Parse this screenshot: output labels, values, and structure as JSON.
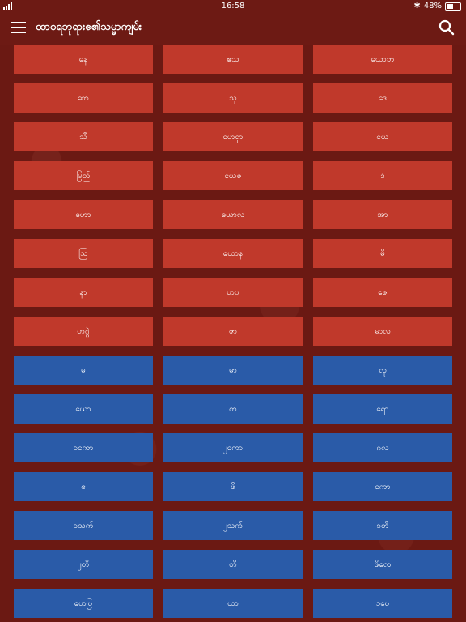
{
  "status_bar": {
    "time": "16:58",
    "bluetooth": "✱",
    "battery_percent": "48%",
    "battery_level": 0.48
  },
  "nav": {
    "title": "ထာဝရဘုရားဧ၏သမ္မာကျမ်း",
    "menu_icon": "hamburger-icon",
    "search_icon": "search-icon"
  },
  "colors": {
    "red": "#c0392b",
    "blue": "#2a5ba8",
    "background": "#6d1a14"
  },
  "books": [
    {
      "label": "နေ",
      "color": "red"
    },
    {
      "label": "ဧသ",
      "color": "red"
    },
    {
      "label": "ယောဘ",
      "color": "red"
    },
    {
      "label": "ဆာ",
      "color": "red"
    },
    {
      "label": "သု",
      "color": "red"
    },
    {
      "label": "ဒေ",
      "color": "red"
    },
    {
      "label": "သီ",
      "color": "red"
    },
    {
      "label": "ဟေရှာ",
      "color": "red"
    },
    {
      "label": "ယေ",
      "color": "red"
    },
    {
      "label": "မြည်",
      "color": "red"
    },
    {
      "label": "ယေဇ",
      "color": "red"
    },
    {
      "label": "ဒံ",
      "color": "red"
    },
    {
      "label": "ဟော",
      "color": "red"
    },
    {
      "label": "ယောလ",
      "color": "red"
    },
    {
      "label": "အာ",
      "color": "red"
    },
    {
      "label": "ဩ",
      "color": "red"
    },
    {
      "label": "ယောန",
      "color": "red"
    },
    {
      "label": "မိ",
      "color": "red"
    },
    {
      "label": "နာ",
      "color": "red"
    },
    {
      "label": "ဟဗ",
      "color": "red"
    },
    {
      "label": "ဇေ",
      "color": "red"
    },
    {
      "label": "ဟဂ္ဂဲ",
      "color": "red"
    },
    {
      "label": "ဇာ",
      "color": "red"
    },
    {
      "label": "မာလ",
      "color": "red"
    },
    {
      "label": "မ",
      "color": "blue"
    },
    {
      "label": "မာ",
      "color": "blue"
    },
    {
      "label": "လု",
      "color": "blue"
    },
    {
      "label": "ယော",
      "color": "blue"
    },
    {
      "label": "တ",
      "color": "blue"
    },
    {
      "label": "ရော",
      "color": "blue"
    },
    {
      "label": "၁ကော",
      "color": "blue"
    },
    {
      "label": "၂ကော",
      "color": "blue"
    },
    {
      "label": "ဂလ",
      "color": "blue"
    },
    {
      "label": "ဧ",
      "color": "blue"
    },
    {
      "label": "ဖိ",
      "color": "blue"
    },
    {
      "label": "ကော",
      "color": "blue"
    },
    {
      "label": "၁သက်",
      "color": "blue"
    },
    {
      "label": "၂သက်",
      "color": "blue"
    },
    {
      "label": "၁တိ",
      "color": "blue"
    },
    {
      "label": "၂တိ",
      "color": "blue"
    },
    {
      "label": "တိ",
      "color": "blue"
    },
    {
      "label": "ဖိလေ",
      "color": "blue"
    },
    {
      "label": "ဟေပြ",
      "color": "blue"
    },
    {
      "label": "ယာ",
      "color": "blue"
    },
    {
      "label": "၁ပေ",
      "color": "blue"
    }
  ]
}
